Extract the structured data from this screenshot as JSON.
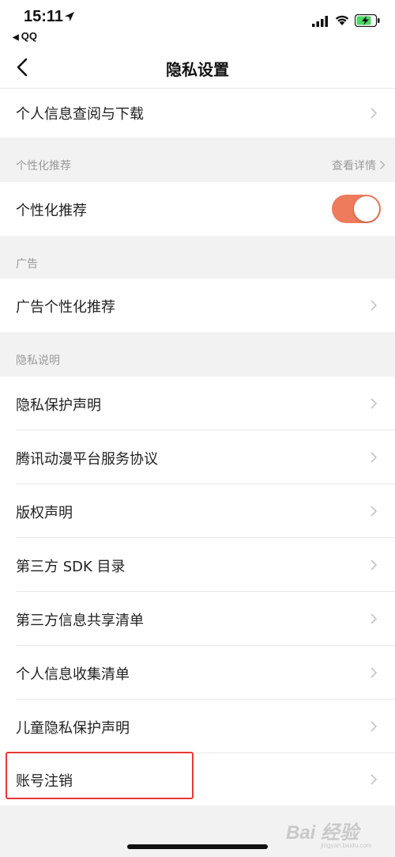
{
  "status_bar": {
    "time": "15:11",
    "back_app": "QQ"
  },
  "nav": {
    "title": "隐私设置"
  },
  "rows": {
    "personal_info": "个人信息查阅与下载",
    "personalized_rec": "个性化推荐",
    "ad_personalized": "广告个性化推荐",
    "privacy_statement": "隐私保护声明",
    "service_agreement": "腾讯动漫平台服务协议",
    "copyright": "版权声明",
    "sdk_list": "第三方 SDK 目录",
    "third_party_share": "第三方信息共享清单",
    "info_collection": "个人信息收集清单",
    "child_privacy": "儿童隐私保护声明",
    "account_cancel": "账号注销"
  },
  "sections": {
    "personalization": "个性化推荐",
    "personalization_detail": "查看详情",
    "ads": "广告",
    "privacy_notes": "隐私说明"
  },
  "toggle": {
    "personalized_rec_on": true,
    "on_color": "#ee7b5c"
  },
  "highlight_color": "#e53935",
  "watermark": {
    "text": "Bai 经验",
    "sub": "jingyan.baidu.com"
  }
}
